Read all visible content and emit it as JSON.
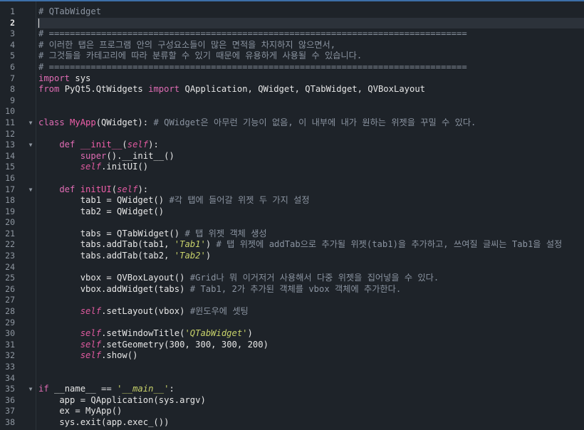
{
  "editor": {
    "current_line": 2,
    "lines": [
      {
        "n": "1",
        "fold": false,
        "seg": [
          {
            "t": "# QTabWidget",
            "c": "cm"
          }
        ]
      },
      {
        "n": "2",
        "fold": false,
        "seg": []
      },
      {
        "n": "3",
        "fold": false,
        "seg": [
          {
            "t": "# ================================================================================",
            "c": "cm"
          }
        ]
      },
      {
        "n": "4",
        "fold": false,
        "seg": [
          {
            "t": "# 이러한 탭은 프로그램 안의 구성요소들이 많은 면적을 차지하지 않으면서,",
            "c": "cm"
          }
        ]
      },
      {
        "n": "5",
        "fold": false,
        "seg": [
          {
            "t": "# 그것들을 카테고리에 따라 분류할 수 있기 때문에 유용하게 사용될 수 있습니다.",
            "c": "cm"
          }
        ]
      },
      {
        "n": "6",
        "fold": false,
        "seg": [
          {
            "t": "# ================================================================================",
            "c": "cm"
          }
        ]
      },
      {
        "n": "7",
        "fold": false,
        "seg": [
          {
            "t": "import",
            "c": "kw"
          },
          {
            "t": " sys",
            "c": "plain"
          }
        ]
      },
      {
        "n": "8",
        "fold": false,
        "seg": [
          {
            "t": "from",
            "c": "kw"
          },
          {
            "t": " PyQt5.QtWidgets ",
            "c": "plain"
          },
          {
            "t": "import",
            "c": "kw"
          },
          {
            "t": " QApplication, QWidget, QTabWidget, QVBoxLayout",
            "c": "plain"
          }
        ]
      },
      {
        "n": "9",
        "fold": false,
        "seg": []
      },
      {
        "n": "10",
        "fold": false,
        "seg": []
      },
      {
        "n": "11",
        "fold": true,
        "seg": [
          {
            "t": "class ",
            "c": "kw"
          },
          {
            "t": "MyApp",
            "c": "fn"
          },
          {
            "t": "(QWidget): ",
            "c": "plain"
          },
          {
            "t": "# QWidget은 아무런 기능이 없음, 이 내부에 내가 원하는 위젯을 꾸밀 수 있다.",
            "c": "cm"
          }
        ]
      },
      {
        "n": "12",
        "fold": false,
        "seg": []
      },
      {
        "n": "13",
        "fold": true,
        "seg": [
          {
            "t": "    def ",
            "c": "kw"
          },
          {
            "t": "__init__",
            "c": "fn"
          },
          {
            "t": "(",
            "c": "plain"
          },
          {
            "t": "self",
            "c": "self"
          },
          {
            "t": "):",
            "c": "plain"
          }
        ]
      },
      {
        "n": "14",
        "fold": false,
        "seg": [
          {
            "t": "        ",
            "c": "plain"
          },
          {
            "t": "super",
            "c": "kw"
          },
          {
            "t": "().__init__()",
            "c": "plain"
          }
        ]
      },
      {
        "n": "15",
        "fold": false,
        "seg": [
          {
            "t": "        ",
            "c": "plain"
          },
          {
            "t": "self",
            "c": "self"
          },
          {
            "t": ".initUI()",
            "c": "plain"
          }
        ]
      },
      {
        "n": "16",
        "fold": false,
        "seg": []
      },
      {
        "n": "17",
        "fold": true,
        "seg": [
          {
            "t": "    def ",
            "c": "kw"
          },
          {
            "t": "initUI",
            "c": "fn"
          },
          {
            "t": "(",
            "c": "plain"
          },
          {
            "t": "self",
            "c": "self"
          },
          {
            "t": "):",
            "c": "plain"
          }
        ]
      },
      {
        "n": "18",
        "fold": false,
        "seg": [
          {
            "t": "        tab1 = QWidget() ",
            "c": "plain"
          },
          {
            "t": "#각 탭에 들어갈 위젯 두 가지 설정",
            "c": "cm"
          }
        ]
      },
      {
        "n": "19",
        "fold": false,
        "seg": [
          {
            "t": "        tab2 = QWidget()",
            "c": "plain"
          }
        ]
      },
      {
        "n": "20",
        "fold": false,
        "seg": []
      },
      {
        "n": "21",
        "fold": false,
        "seg": [
          {
            "t": "        tabs = QTabWidget() ",
            "c": "plain"
          },
          {
            "t": "# 탭 위젯 객체 생성",
            "c": "cm"
          }
        ]
      },
      {
        "n": "22",
        "fold": false,
        "seg": [
          {
            "t": "        tabs.addTab(tab1, ",
            "c": "plain"
          },
          {
            "t": "'Tab1'",
            "c": "str"
          },
          {
            "t": ") ",
            "c": "plain"
          },
          {
            "t": "# 탭 위젯에 addTab으로 추가될 위젯(tab1)을 추가하고, 쓰여질 글씨는 Tab1을 설정",
            "c": "cm"
          }
        ]
      },
      {
        "n": "23",
        "fold": false,
        "seg": [
          {
            "t": "        tabs.addTab(tab2, ",
            "c": "plain"
          },
          {
            "t": "'Tab2'",
            "c": "str"
          },
          {
            "t": ")",
            "c": "plain"
          }
        ]
      },
      {
        "n": "24",
        "fold": false,
        "seg": []
      },
      {
        "n": "25",
        "fold": false,
        "seg": [
          {
            "t": "        vbox = QVBoxLayout() ",
            "c": "plain"
          },
          {
            "t": "#Grid나 뭐 이거저거 사용해서 다중 위젯을 집어넣을 수 있다.",
            "c": "cm"
          }
        ]
      },
      {
        "n": "26",
        "fold": false,
        "seg": [
          {
            "t": "        vbox.addWidget(tabs) ",
            "c": "plain"
          },
          {
            "t": "# Tab1, 2가 추가된 객체를 vbox 객체에 추가한다.",
            "c": "cm"
          }
        ]
      },
      {
        "n": "27",
        "fold": false,
        "seg": []
      },
      {
        "n": "28",
        "fold": false,
        "seg": [
          {
            "t": "        ",
            "c": "plain"
          },
          {
            "t": "self",
            "c": "self"
          },
          {
            "t": ".setLayout(vbox) ",
            "c": "plain"
          },
          {
            "t": "#윈도우에 셋팅",
            "c": "cm"
          }
        ]
      },
      {
        "n": "29",
        "fold": false,
        "seg": []
      },
      {
        "n": "30",
        "fold": false,
        "seg": [
          {
            "t": "        ",
            "c": "plain"
          },
          {
            "t": "self",
            "c": "self"
          },
          {
            "t": ".setWindowTitle(",
            "c": "plain"
          },
          {
            "t": "'QTabWidget'",
            "c": "str"
          },
          {
            "t": ")",
            "c": "plain"
          }
        ]
      },
      {
        "n": "31",
        "fold": false,
        "seg": [
          {
            "t": "        ",
            "c": "plain"
          },
          {
            "t": "self",
            "c": "self"
          },
          {
            "t": ".setGeometry(",
            "c": "plain"
          },
          {
            "t": "300",
            "c": "num"
          },
          {
            "t": ", ",
            "c": "plain"
          },
          {
            "t": "300",
            "c": "num"
          },
          {
            "t": ", ",
            "c": "plain"
          },
          {
            "t": "300",
            "c": "num"
          },
          {
            "t": ", ",
            "c": "plain"
          },
          {
            "t": "200",
            "c": "num"
          },
          {
            "t": ")",
            "c": "plain"
          }
        ]
      },
      {
        "n": "32",
        "fold": false,
        "seg": [
          {
            "t": "        ",
            "c": "plain"
          },
          {
            "t": "self",
            "c": "self"
          },
          {
            "t": ".show()",
            "c": "plain"
          }
        ]
      },
      {
        "n": "33",
        "fold": false,
        "seg": []
      },
      {
        "n": "34",
        "fold": false,
        "seg": []
      },
      {
        "n": "35",
        "fold": true,
        "seg": [
          {
            "t": "if",
            "c": "kw"
          },
          {
            "t": " __name__ == ",
            "c": "plain"
          },
          {
            "t": "'__main__'",
            "c": "str"
          },
          {
            "t": ":",
            "c": "plain"
          }
        ]
      },
      {
        "n": "36",
        "fold": false,
        "seg": [
          {
            "t": "    app = QApplication(sys.argv)",
            "c": "plain"
          }
        ]
      },
      {
        "n": "37",
        "fold": false,
        "seg": [
          {
            "t": "    ex = MyApp()",
            "c": "plain"
          }
        ]
      },
      {
        "n": "38",
        "fold": false,
        "seg": [
          {
            "t": "    sys.exit(app.exec_())",
            "c": "plain"
          }
        ]
      }
    ]
  },
  "icons": {
    "fold": "fold-triangle-icon"
  },
  "colors": {
    "background": "#1e2329",
    "current_line": "#2c323a",
    "keyword": "#e06cb4",
    "string": "#c8d26a",
    "comment": "#8a93a0"
  }
}
